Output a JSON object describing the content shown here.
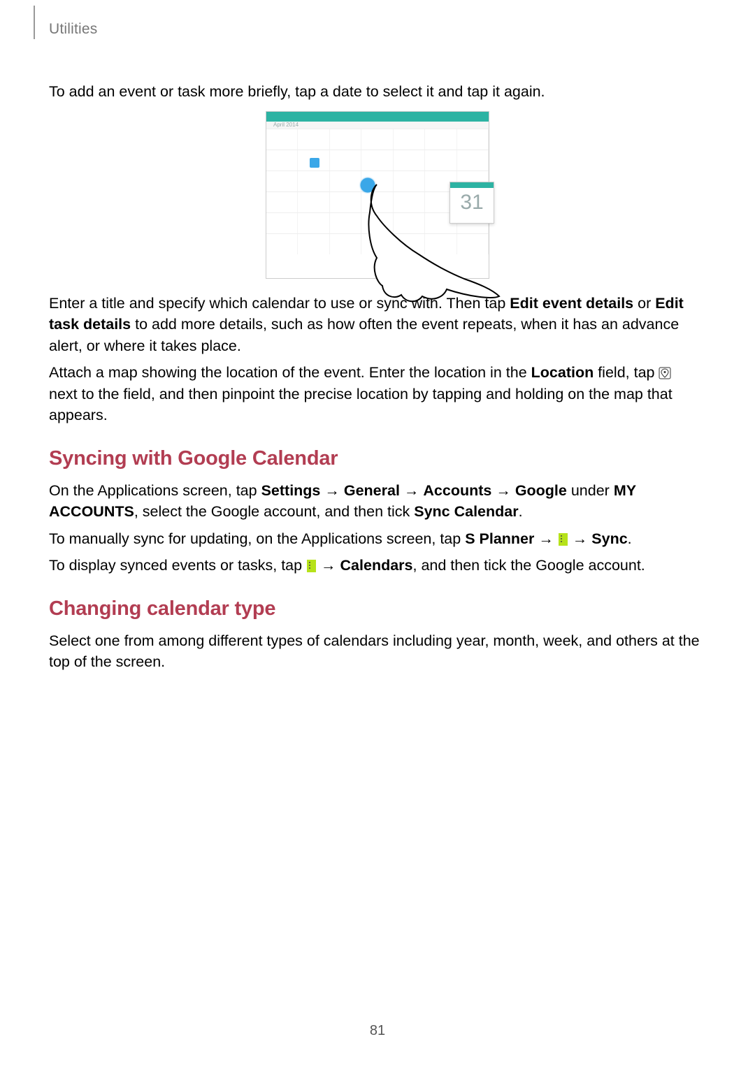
{
  "header": {
    "section": "Utilities"
  },
  "intro": {
    "p1": "To add an event or task more briefly, tap a date to select it and tap it again."
  },
  "figure": {
    "month_label": "April 2014",
    "badge_day": "31"
  },
  "edit": {
    "p2_a": "Enter a title and specify which calendar to use or sync with. Then tap ",
    "p2_b": "Edit event details",
    "p2_c": " or ",
    "p2_d": "Edit task details",
    "p2_e": " to add more details, such as how often the event repeats, when it has an advance alert, or where it takes place."
  },
  "attach": {
    "p3_a": "Attach a map showing the location of the event. Enter the location in the ",
    "p3_b": "Location",
    "p3_c": " field, tap ",
    "p3_d": " next to the field, and then pinpoint the precise location by tapping and holding on the map that appears."
  },
  "sync": {
    "heading": "Syncing with Google Calendar",
    "p4_a": "On the Applications screen, tap ",
    "p4_b": "Settings",
    "arrow": " → ",
    "p4_c": "General",
    "p4_d": "Accounts",
    "p4_e": "Google",
    "p4_f": " under ",
    "p4_g": "MY ACCOUNTS",
    "p4_h": ", select the Google account, and then tick ",
    "p4_i": "Sync Calendar",
    "p4_j": ".",
    "p5_a": "To manually sync for updating, on the Applications screen, tap ",
    "p5_b": "S Planner",
    "p5_c": "Sync",
    "p5_d": ".",
    "p6_a": "To display synced events or tasks, tap ",
    "p6_b": "Calendars",
    "p6_c": ", and then tick the Google account."
  },
  "change": {
    "heading": "Changing calendar type",
    "p7": "Select one from among different types of calendars including year, month, week, and others at the top of the screen."
  },
  "footer": {
    "page": "81"
  }
}
